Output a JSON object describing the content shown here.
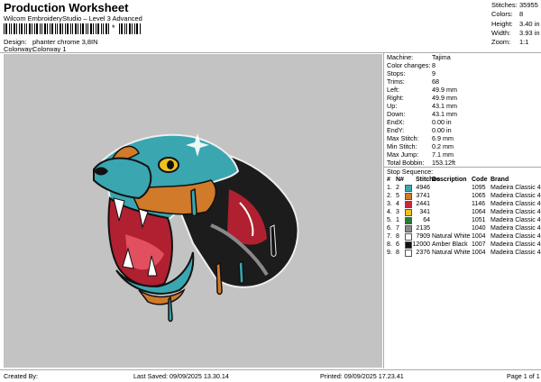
{
  "header": {
    "title": "Production Worksheet",
    "subtitle": "Wilcom EmbroideryStudio – Level 3 Advanced",
    "barcode_char": "*"
  },
  "design": {
    "design_label": "Design:",
    "design_value": "phanter chrome 3,8IN",
    "colorway_label": "Colorway:",
    "colorway_value": "Colorway 1"
  },
  "stats": [
    {
      "k": "Stitches:",
      "v": "35955"
    },
    {
      "k": "Colors:",
      "v": "8"
    },
    {
      "k": "Height:",
      "v": "3.40 in"
    },
    {
      "k": "Width:",
      "v": "3.93 in"
    },
    {
      "k": "Zoom:",
      "v": "1:1"
    }
  ],
  "info": [
    {
      "k": "Machine:",
      "v": "Tajima"
    },
    {
      "k": "Color changes:",
      "v": "8"
    },
    {
      "k": "Stops:",
      "v": "9"
    },
    {
      "k": "Trims:",
      "v": "68"
    },
    {
      "k": "Left:",
      "v": "49.9 mm"
    },
    {
      "k": "Right:",
      "v": "49.9 mm"
    },
    {
      "k": "Up:",
      "v": "43.1 mm"
    },
    {
      "k": "Down:",
      "v": "43.1 mm"
    },
    {
      "k": "EndX:",
      "v": "0.00 in"
    },
    {
      "k": "EndY:",
      "v": "0.00 in"
    },
    {
      "k": "Max Stitch:",
      "v": "6.9 mm"
    },
    {
      "k": "Min Stitch:",
      "v": "0.2 mm"
    },
    {
      "k": "Max Jump:",
      "v": "7.1 mm"
    },
    {
      "k": "Total Bobbin:",
      "v": "153.12ft"
    }
  ],
  "stop_sequence": {
    "title": "Stop Sequence:",
    "headers": [
      "#",
      "N#",
      "Stitches",
      "Description",
      "Code",
      "Brand"
    ],
    "rows": [
      {
        "n": "1.",
        "c": "2",
        "color": "#3aa6b0",
        "st": "4946",
        "desc": "",
        "code": "1095",
        "brand": "Madeira Classic 40"
      },
      {
        "n": "2.",
        "c": "5",
        "color": "#d07a2a",
        "st": "3741",
        "desc": "",
        "code": "1065",
        "brand": "Madeira Classic 40"
      },
      {
        "n": "3.",
        "c": "4",
        "color": "#c8283a",
        "st": "2441",
        "desc": "",
        "code": "1146",
        "brand": "Madeira Classic 40"
      },
      {
        "n": "4.",
        "c": "3",
        "color": "#f0c020",
        "st": "341",
        "desc": "",
        "code": "1064",
        "brand": "Madeira Classic 40"
      },
      {
        "n": "5.",
        "c": "1",
        "color": "#2a7a3a",
        "st": "64",
        "desc": "",
        "code": "1051",
        "brand": "Madeira Classic 40"
      },
      {
        "n": "6.",
        "c": "7",
        "color": "#8a8a8a",
        "st": "2135",
        "desc": "",
        "code": "1040",
        "brand": "Madeira Classic 40"
      },
      {
        "n": "7.",
        "c": "8",
        "color": "#ffffff",
        "st": "7909",
        "desc": "Natural White",
        "code": "1004",
        "brand": "Madeira Classic 40"
      },
      {
        "n": "8.",
        "c": "6",
        "color": "#111111",
        "st": "12000",
        "desc": "Amber Black",
        "code": "1007",
        "brand": "Madeira Classic 40"
      },
      {
        "n": "9.",
        "c": "8",
        "color": "#ffffff",
        "st": "2376",
        "desc": "Natural White",
        "code": "1004",
        "brand": "Madeira Classic 40"
      }
    ]
  },
  "footer": {
    "created_by": "Created By:",
    "last_saved": "Last Saved: 09/09/2025 13.30.14",
    "printed": "Printed: 09/09/2025 17.23.41",
    "page": "Page 1 of 1"
  }
}
